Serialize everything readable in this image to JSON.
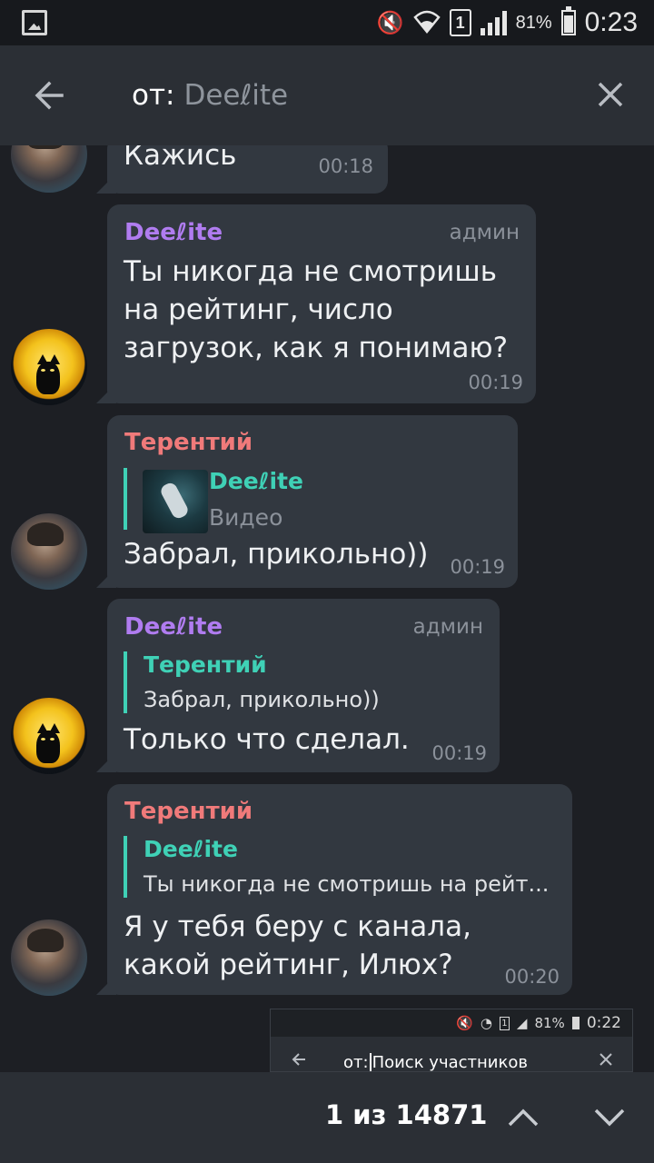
{
  "status_bar": {
    "battery_percent": "81%",
    "battery_level": 0.81,
    "time": "0:23",
    "sim_slot": "1",
    "icons": [
      "gallery-icon",
      "mute-vibrate-icon",
      "wifi-icon",
      "sim-icon",
      "signal-icon",
      "battery-icon"
    ]
  },
  "header": {
    "search_prefix": "от:",
    "search_user": "Deeℓite",
    "back_icon": "arrow-left-icon",
    "close_icon": "close-icon"
  },
  "messages": [
    {
      "text": "Кажись",
      "time": "00:18"
    },
    {
      "sender": "Deeℓite",
      "role": "админ",
      "text": "Ты никогда не смотришь\nна рейтинг, число\nзагрузок, как я понимаю?",
      "time": "00:19"
    },
    {
      "sender": "Терентий",
      "reply_name": "Deeℓite",
      "reply_text": "Видео",
      "text": "Забрал, прикольно))",
      "time": "00:19"
    },
    {
      "sender": "Deeℓite",
      "role": "админ",
      "reply_name": "Терентий",
      "reply_text": "Забрал, прикольно))",
      "text": "Только что сделал.",
      "time": "00:19"
    },
    {
      "sender": "Терентий",
      "reply_name": "Deeℓite",
      "reply_text": "Ты никогда не смотришь на рейт...",
      "text": "Я у тебя беру с канала,\nкакой рейтинг, Илюх?",
      "time": "00:20"
    }
  ],
  "screenshot_preview": {
    "battery_percent": "81%",
    "time": "0:22",
    "sim_slot": "1",
    "search_prefix": "от:",
    "search_placeholder": "Поиск участников"
  },
  "footer": {
    "counter": "1 из 14871",
    "up_icon": "chevron-up-icon",
    "down_icon": "chevron-down-icon"
  },
  "colors": {
    "background": "#1d1f24",
    "bar": "#2b2f35",
    "bubble": "#323840",
    "admin_name": "#b07cf0",
    "terentiy_name": "#f07a7a",
    "reply_accent": "#3fd1b6"
  }
}
